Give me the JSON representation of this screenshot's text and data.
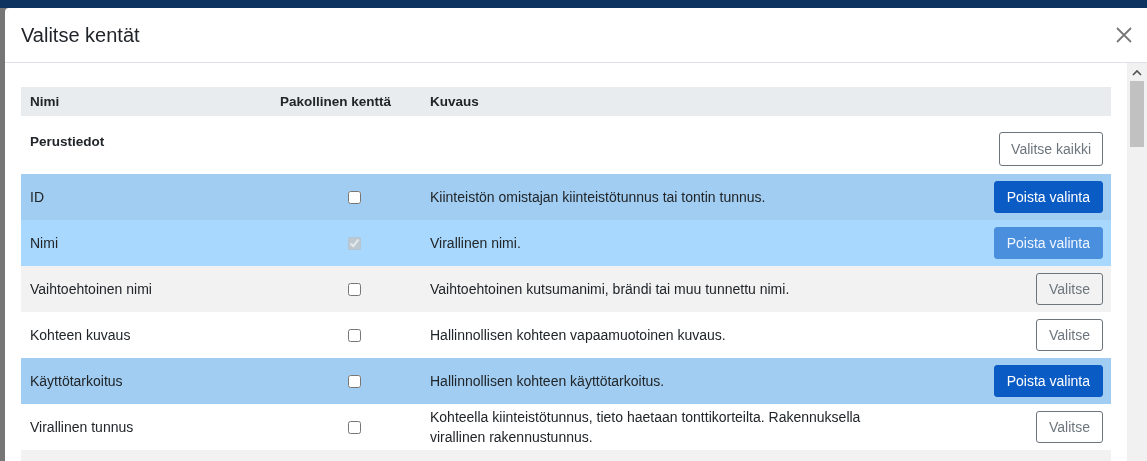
{
  "dialog": {
    "title": "Valitse kentät"
  },
  "table": {
    "columns": [
      "Nimi",
      "Pakollinen kenttä",
      "Kuvaus"
    ],
    "section": {
      "title": "Perustiedot",
      "button": "Valitse kaikki"
    },
    "rows": [
      {
        "name": "ID",
        "required": false,
        "description": "Kiinteistön omistajan kiinteistötunnus tai tontin tunnus.",
        "selected": true,
        "disabled": false,
        "hovered": false,
        "button": "Poista valinta"
      },
      {
        "name": "Nimi",
        "required": true,
        "description": "Virallinen nimi.",
        "selected": true,
        "disabled": true,
        "hovered": false,
        "button": "Poista valinta"
      },
      {
        "name": "Vaihtoehtoinen nimi",
        "required": false,
        "description": "Vaihtoehtoinen kutsumanimi, brändi tai muu tunnettu nimi.",
        "selected": false,
        "disabled": false,
        "hovered": true,
        "button": "Valitse"
      },
      {
        "name": "Kohteen kuvaus",
        "required": false,
        "description": "Hallinnollisen kohteen vapaamuotoinen kuvaus.",
        "selected": false,
        "disabled": false,
        "hovered": false,
        "button": "Valitse"
      },
      {
        "name": "Käyttötarkoitus",
        "required": false,
        "description": "Hallinnollisen kohteen käyttötarkoitus.",
        "selected": true,
        "disabled": false,
        "hovered": false,
        "button": "Poista valinta"
      },
      {
        "name": "Virallinen tunnus",
        "required": false,
        "description": "Kohteella kiinteistötunnus, tieto haetaan tonttikorteilta. Rakennuksella virallinen rakennustunnus.",
        "selected": false,
        "disabled": false,
        "hovered": false,
        "button": "Valitse"
      }
    ]
  }
}
